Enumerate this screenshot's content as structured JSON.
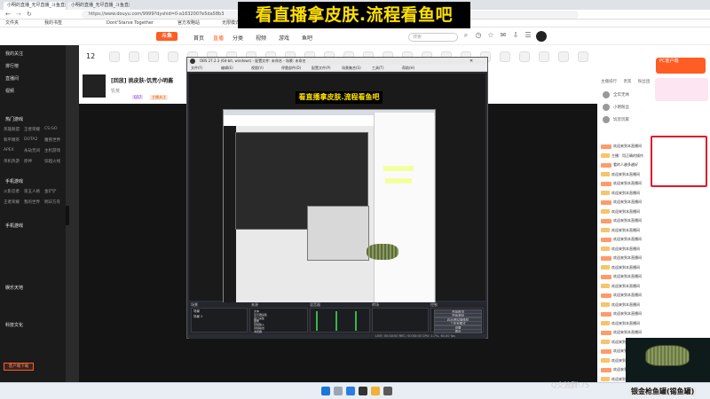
{
  "overlay_title": "看直播拿皮肤.流程看鱼吧",
  "browser": {
    "tabs": [
      "小明的直播_无尽直播_斗鱼直播",
      "小明的直播_无尽直播_斗鱼直播"
    ],
    "url": "https://www.douyu.com/9999?dyshid=0-a1632007e5da58b3",
    "bookmarks": [
      "文件夹",
      "我的书签",
      "Dont'Starve Together",
      "官方攻略站",
      "无限模式"
    ]
  },
  "site": {
    "logo": "斗鱼",
    "nav": [
      "首页",
      "直播",
      "分类",
      "视频",
      "游戏",
      "鱼吧"
    ],
    "search_placeholder": "搜索"
  },
  "sidebar": {
    "items": [
      "我的关注",
      "排行榜",
      "直播间",
      "视频"
    ],
    "section1": "热门游戏",
    "section2": "手机游戏",
    "section3": "娱乐天地",
    "section4": "科技文化",
    "grid1": [
      "英雄联盟",
      "王者荣耀",
      "CS:GO",
      "和平精英",
      "DOTA2",
      "魔兽世界",
      "APEX",
      "永劫无间",
      "主机游戏",
      "单机热游",
      "原神",
      "穿越火线"
    ],
    "grid2": [
      "火影忍者",
      "第五人格",
      "金铲铲",
      "王者荣耀",
      "我的世界",
      "明日方舟"
    ],
    "bottom_button": "客户端下载"
  },
  "room": {
    "rank": "12",
    "title": "[回放] 挑皮肤-饥荒小明酱",
    "subtitle": "饥荒",
    "tags": [
      "Q17",
      "主播关注"
    ]
  },
  "obs": {
    "title": "OBS 27.2.3 (64-bit, windows) - 配置文件: 未命名 - 场景: 未命名",
    "menu": [
      "文件(F)",
      "编辑(E)",
      "视图(V)",
      "停靠部件(D)",
      "配置文件(P)",
      "场景集合(S)",
      "工具(T)",
      "帮助(H)"
    ],
    "nested_banner": "看直播拿皮肤.流程看鱼吧",
    "docks": [
      "场景",
      "来源",
      "混音器",
      "转场",
      "控制"
    ],
    "controls": [
      "开始推流",
      "开始录制",
      "启动虚拟摄像机",
      "工作室模式",
      "设置",
      "退出"
    ],
    "scene_items": [
      "场景",
      "场景 2"
    ],
    "source_items": [
      "文本",
      "显示器采集",
      "窗口采集",
      "图像",
      "音频输入",
      "音频输出",
      "浏览器"
    ],
    "status": "LIVE: 00:00:00   REC: 00:00:00   CPU: 1.7%, 60.00 fps"
  },
  "chat": {
    "banner": "PC客户端",
    "tabs": [
      "主播排行",
      "贵宾",
      "粉丝团"
    ],
    "users": [
      "全年无休",
      "小明粉丝",
      "饥荒玩家"
    ],
    "messages": [
      "欢迎来到本直播间",
      "主播：用正确的操作",
      "看的人越多越好",
      "欢迎来到本直播间",
      "欢迎来到本直播间",
      "欢迎来到本直播间",
      "欢迎来到本直播间",
      "欢迎来到本直播间",
      "欢迎来到本直播间",
      "欢迎来到本直播间",
      "欢迎来到本直播间",
      "欢迎来到本直播间",
      "欢迎来到本直播间",
      "欢迎来到本直播间",
      "欢迎来到本直播间",
      "欢迎来到本直播间",
      "欢迎来到本直播间",
      "欢迎来到本直播间",
      "欢迎来到本直播间",
      "欢迎来到本直播间",
      "欢迎来到本直播间",
      "欢迎来到本直播间",
      "欢迎来到本直播间",
      "欢迎来到本直播间",
      "欢迎来到本直播间",
      "欢迎来到本直播间"
    ],
    "footer_text": "银金枪鱼罐(锡鱼罐)",
    "jiaoliu": "Q交流群:75"
  },
  "colors": {
    "accent": "#ff5d23",
    "overlay_text": "#ffe100",
    "highlight_box": "#e0182a"
  }
}
